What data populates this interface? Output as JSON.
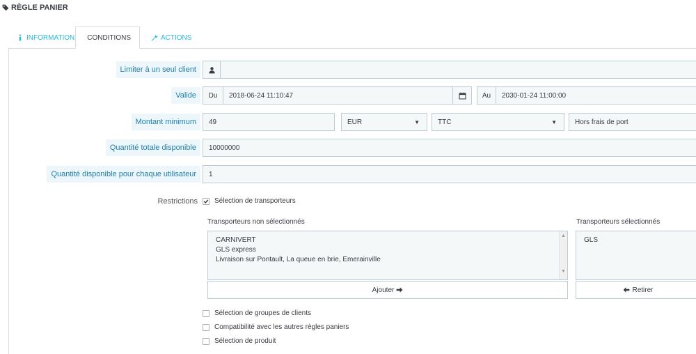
{
  "header": {
    "title": "RÈGLE PANIER"
  },
  "tabs": [
    {
      "label": "INFORMATIONS",
      "active": false
    },
    {
      "label": "CONDITIONS",
      "active": true
    },
    {
      "label": "ACTIONS",
      "active": false
    }
  ],
  "form": {
    "client": {
      "label": "Limiter à un seul client",
      "value": ""
    },
    "valid": {
      "label": "Valide",
      "from_prefix": "Du",
      "from_value": "2018-06-24 11:10:47",
      "to_prefix": "Au",
      "to_value": "2030-01-24 11:00:00"
    },
    "minimum": {
      "label": "Montant minimum",
      "amount": "49",
      "currency": "EUR",
      "tax": "TTC",
      "shipping": "Hors frais de port"
    },
    "total_quantity": {
      "label": "Quantité totale disponible",
      "value": "10000000"
    },
    "per_user_quantity": {
      "label": "Quantité disponible pour chaque utilisateur",
      "value": "1"
    },
    "restrictions": {
      "label": "Restrictions",
      "carrier_selection": {
        "label": "Sélection de transporteurs",
        "checked": true
      },
      "unselected_title": "Transporteurs non sélectionnés",
      "unselected": [
        "CARNIVERT",
        "GLS express",
        "Livraison sur Pontault, La queue en brie, Emerainville"
      ],
      "selected_title": "Transporteurs sélectionnés",
      "selected": [
        "GLS"
      ],
      "add_label": "Ajouter",
      "remove_label": "Retirer",
      "group_selection": {
        "label": "Sélection de groupes de clients",
        "checked": false
      },
      "compatibility": {
        "label": "Compatibilité avec les autres règles paniers",
        "checked": false
      },
      "product_selection": {
        "label": "Sélection de produit",
        "checked": false
      }
    }
  },
  "colors": {
    "accent": "#25b9d7",
    "label_bg": "#edf6fb",
    "label_text": "#1e7fa6",
    "field_bg": "#f5f8f9",
    "field_border": "#bbcdd2"
  }
}
